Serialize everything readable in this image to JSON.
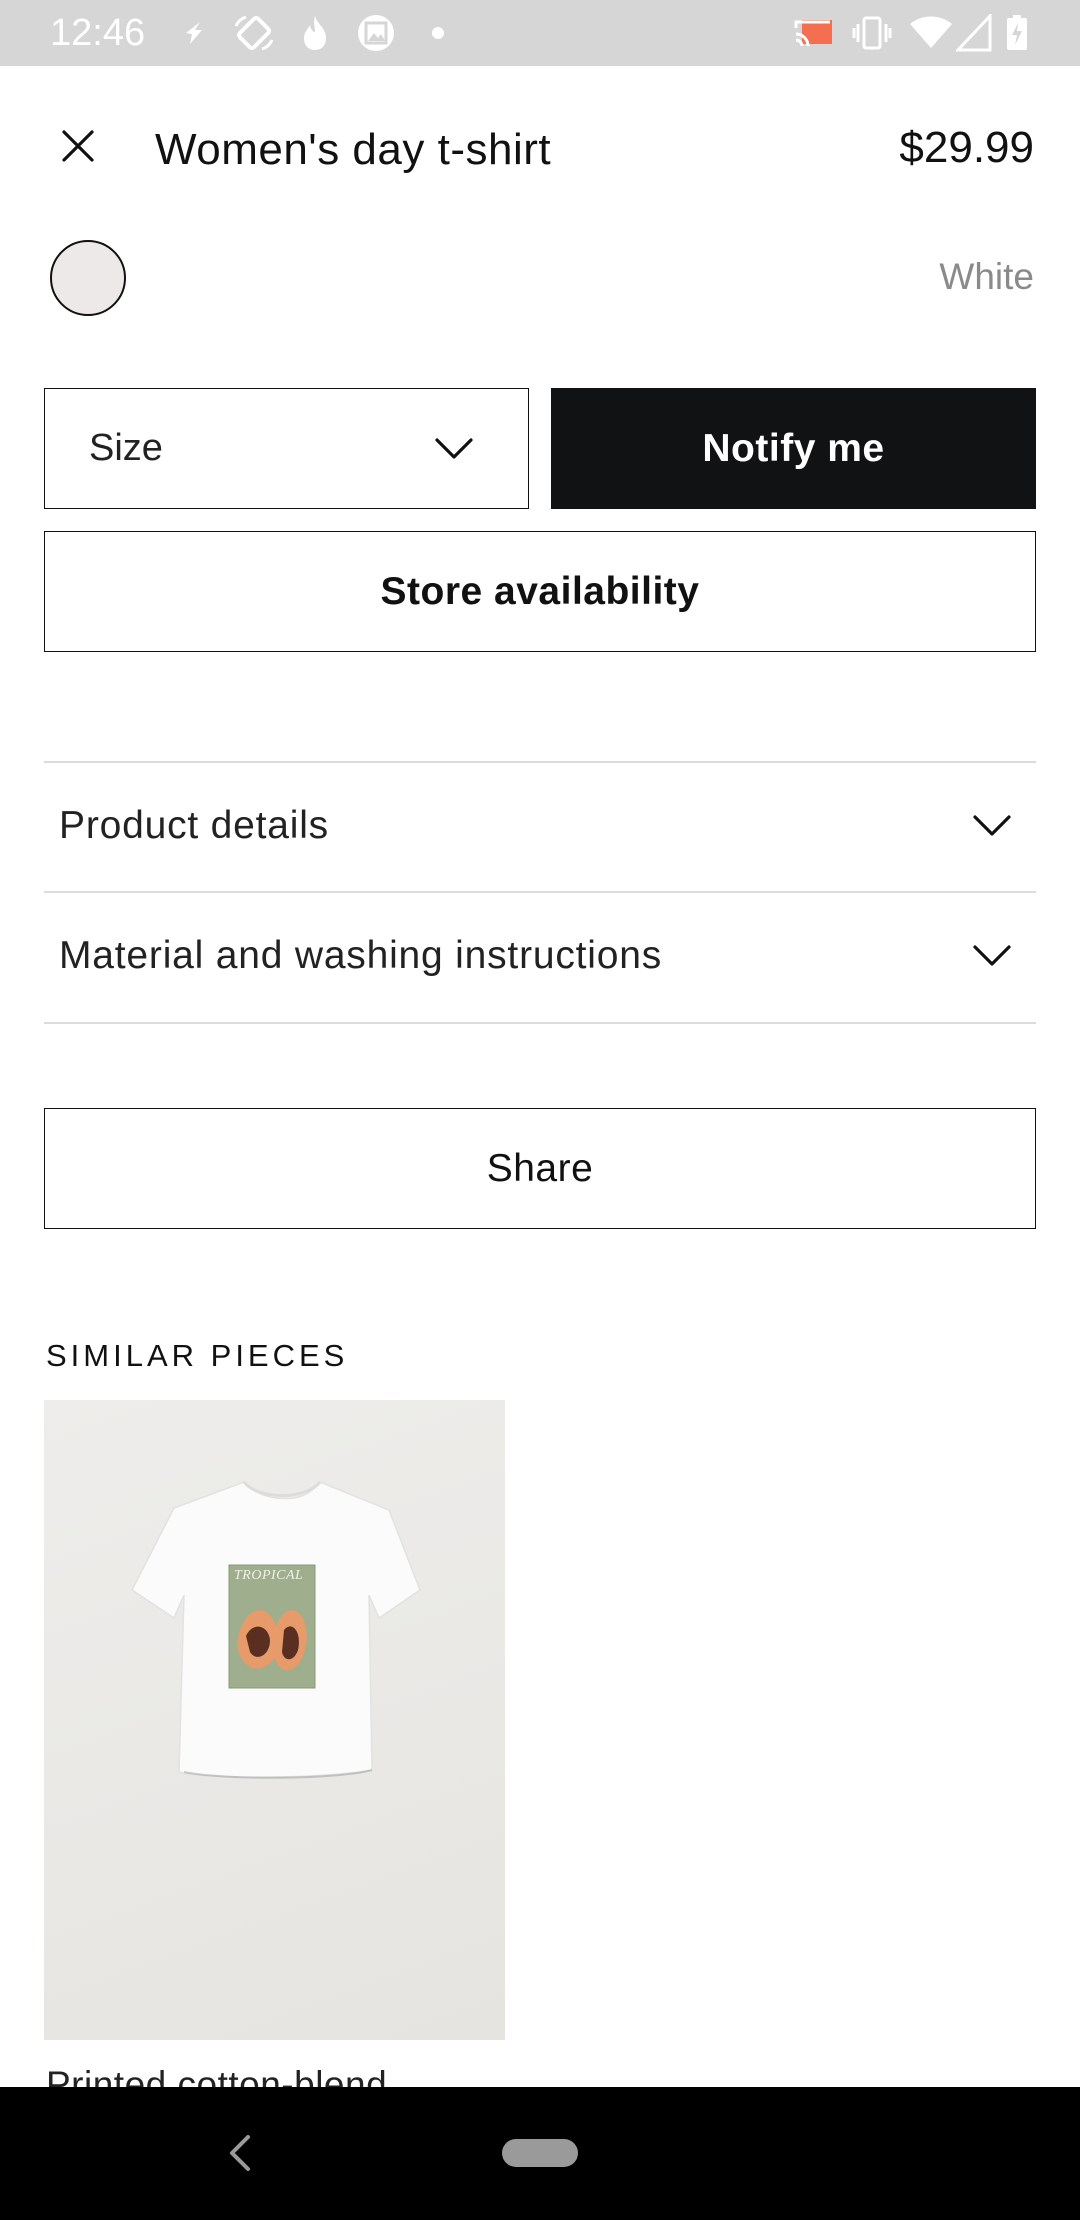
{
  "status_bar": {
    "time": "12:46",
    "background": "#d6d6d6",
    "left_icons": [
      "location-arrow-icon",
      "rotate-screen-icon",
      "fire-icon",
      "photo-app-icon",
      "dot-icon"
    ],
    "right_icons": [
      "cast-icon",
      "vibrate-icon",
      "wifi-icon",
      "cell-signal-icon",
      "battery-charging-icon"
    ]
  },
  "header": {
    "close_icon": "close-icon",
    "title": "Women's day t-shirt",
    "price": "$29.99"
  },
  "color": {
    "swatch_color": "#ece9e8",
    "name": "White"
  },
  "actions": {
    "size_label": "Size",
    "size_icon": "chevron-down-icon",
    "notify_label": "Notify me",
    "store_label": "Store availability",
    "share_label": "Share"
  },
  "accordions": [
    {
      "label": "Product details",
      "icon": "chevron-down-icon"
    },
    {
      "label": "Material and washing instructions",
      "icon": "chevron-down-icon"
    }
  ],
  "similar": {
    "title": "SIMILAR PIECES",
    "items": [
      {
        "name": "Printed cotton-blend",
        "print_text": "TROPICAL"
      }
    ]
  },
  "nav_bar": {
    "back_icon": "back-chevron-icon",
    "home_icon": "home-pill-icon"
  },
  "colors": {
    "accent_dark": "#111214",
    "text_muted": "#8a8a8a"
  }
}
